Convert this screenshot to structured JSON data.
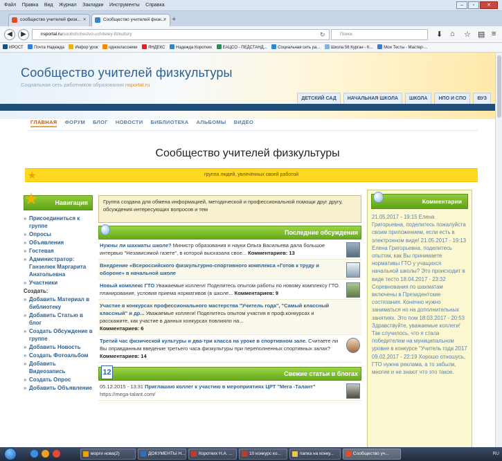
{
  "browser": {
    "menu": [
      "Файл",
      "Правка",
      "Вид",
      "Журнал",
      "Закладки",
      "Инструменты",
      "Справка"
    ],
    "tabs": [
      {
        "label": "сообщество учителей физк..."
      },
      {
        "label": "Сообщество учителей физк..."
      }
    ],
    "url_host": "nsportal.ru",
    "url_path": "/soobshchestvo-uchiteley-fizkultury",
    "search_placeholder": "Поиск",
    "bookmarks": [
      "ИРОСТ",
      "Почта Надежда",
      "Инфор урок",
      "одноклассники",
      "ЯНДЕКС",
      "Надежда Коротких",
      "ЕАЦСО - ПЕДСТАНД...",
      "Социальная сеть ра...",
      "Школа 56 Курган - К...",
      "Мои Тесты - Мастер-..."
    ]
  },
  "site": {
    "title": "Сообщество учителей физкультуры",
    "subtitle": "Социальная сеть работников образования",
    "brand": "nsportal.ru",
    "level_tabs": [
      "ДЕТСКИЙ САД",
      "НАЧАЛЬНАЯ ШКОЛА",
      "ШКОЛА",
      "НПО И СПО",
      "ВУЗ"
    ],
    "main_nav": [
      "ГЛАВНАЯ",
      "ФОРУМ",
      "БЛОГ",
      "НОВОСТИ",
      "БИБЛИОТЕКА",
      "АЛЬБОМЫ",
      "ВИДЕО"
    ],
    "page_title": "Сообщество учителей физкультуры",
    "motto": "группа людей, увлечённых своей работой"
  },
  "left": {
    "heading": "Навигация",
    "items": [
      "Присоединиться к группе",
      "Опросы",
      "Объявления",
      "Гостевая",
      "Администратор: Ганзелюк Маргарита Анатольевна",
      "Участники"
    ],
    "create_label": "Создать:",
    "create_items": [
      "Добавить Материал в библиотеку",
      "Добавить Статью в блог",
      "Создать Обсуждение в группе",
      "Добавить Новость",
      "Создать Фотоальбом",
      "Добавить Видеозапись",
      "Создать Опрос",
      "Добавить Объявление"
    ]
  },
  "center": {
    "intro": "Группа создана для обмена информацией, методической и профессиональной помощи друг другу, обсуждения интересующих вопросов и тем",
    "discussions_heading": "Последние обсуждения",
    "discussions": [
      {
        "title": "Нужны ли шахматы школе?",
        "text": " Министр образования и науки Ольга Васильева дала большое интервью \"Независимой газете\", в которой высказала свое...",
        "comments_label": " Комментариев:",
        "comments": "13"
      },
      {
        "title": "Внедрение «Всероссийского физкультурно-спортивного комплекса «Готов к труду и обороне» в начальной школе",
        "text": "",
        "comments_label": "",
        "comments": ""
      },
      {
        "title": "Новый комплекс ГТО",
        "text": " Уважаемые коллеги! Поделитесь опытом работы по новому комплексу ГТО. планирование, условия приема нормативов (в школе...",
        "comments_label": " Комментариев:",
        "comments": "9"
      },
      {
        "title": "Участие в конкурсах профессионального мастерства \"Учитель года\", \"Самый классный классный\" и др...",
        "text": " Уважаемые коллеги! Поделитесь опытом участия в проф.конкурсах и расскажите, как участие в данных конкурсах повлияло на...",
        "comments_label": "Комментариев:",
        "comments": "6"
      },
      {
        "title": "Третий час физической культуры и два-три класса на уроке в спортивном зале.",
        "text": " Считаете ли Вы оправданным введение третьего часа физкультуры при переполненных спортивных залах?",
        "comments_label": " Комментариев:",
        "comments": "14"
      }
    ],
    "articles_heading": "Свежие статьи в блогах",
    "calendar_day": "12",
    "articles": [
      {
        "date": "05.12.2015 - 13:31",
        "title": "Приглашаю коллег к участию в мероприятиях ЦРТ \"Мега -Талант\"",
        "url": "https://mega-talant.com/"
      }
    ]
  },
  "right": {
    "heading": "Комментарии",
    "text": "21.05.2017 - 19:15 Елена Григорьевна, поделитесь пожалуйста своим приложением, если есть в электронном виде! 21.05.2017 - 19:13 Елена Григорьевна, поделитесь опытом, как Вы принимаете нормативы ГТО у учащихся начальной школы? Это происходит в виде тесто 18.04.2017 - 23:32 Соревнования по шахматам включены в Президентские состязания. Конечно нужно заниматься но на дополнительных занятиях. Это пом 18.03.2017 - 20:53 Здравствуйте, уважаемые коллеги! Так случилось, что я стала победителем на муниципальном уровне в конкурсе \"Учитель года 2017 09.02.2017 - 22:19 Хорошо отношусь, ГТО нужна реклама, а то забыли, многие и не знают что это такое."
  },
  "taskbar": {
    "tasks": [
      "морги нова(2)",
      "ДОКУМЕНТЫ Н...",
      "Коротких Н.А. ...",
      "10 конкурс ко...",
      "папка на конку...",
      "Сообщество уч..."
    ],
    "tray_lang": "RU"
  },
  "colors": {
    "accent_green": "#64aa1b",
    "header_blue": "#1f4e7a",
    "motto_yellow": "#ffd91f",
    "link_blue": "#2d5f8f"
  }
}
